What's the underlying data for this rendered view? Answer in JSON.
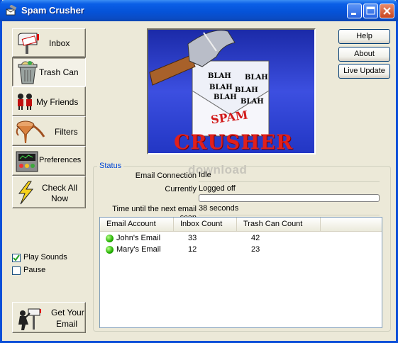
{
  "window": {
    "title": "Spam Crusher"
  },
  "nav": {
    "inbox": "Inbox",
    "trash_can": "Trash Can",
    "my_friends": "My Friends",
    "filters": "Filters",
    "preferences": "Preferences",
    "check_all_line1": "Check All",
    "check_all_line2": "Now",
    "get_email_line1": "Get Your",
    "get_email_line2": "Email",
    "active": "trash_can"
  },
  "options": {
    "play_sounds": {
      "label": "Play Sounds",
      "checked": true
    },
    "pause": {
      "label": "Pause",
      "checked": false
    }
  },
  "buttons": {
    "help": "Help",
    "about": "About",
    "live_update": "Live Update"
  },
  "banner": {
    "blah_text": "BLAH",
    "spam_text": "SPAM",
    "logo_text": "CRUSHER"
  },
  "status": {
    "group_title": "Status",
    "email_connection_label": "Email Connection",
    "email_connection_value": "Idle",
    "currently_label": "Currently",
    "currently_value": "Logged off",
    "next_scan_label": "Time until the next email scan",
    "next_scan_value": "38 seconds",
    "progress": 0
  },
  "accounts_table": {
    "columns": [
      "Email Account",
      "Inbox Count",
      "Trash Can Count"
    ],
    "rows": [
      {
        "account": "John's Email",
        "inbox": "33",
        "trash": "42",
        "status": "online"
      },
      {
        "account": "Mary's Email",
        "inbox": "12",
        "trash": "23",
        "status": "online"
      }
    ]
  },
  "watermark": "download",
  "colors": {
    "title_bar": "#0553d8",
    "group_title": "#0046d5",
    "banner_bg": "#2c3fd2",
    "logo_red": "#e0201c"
  }
}
